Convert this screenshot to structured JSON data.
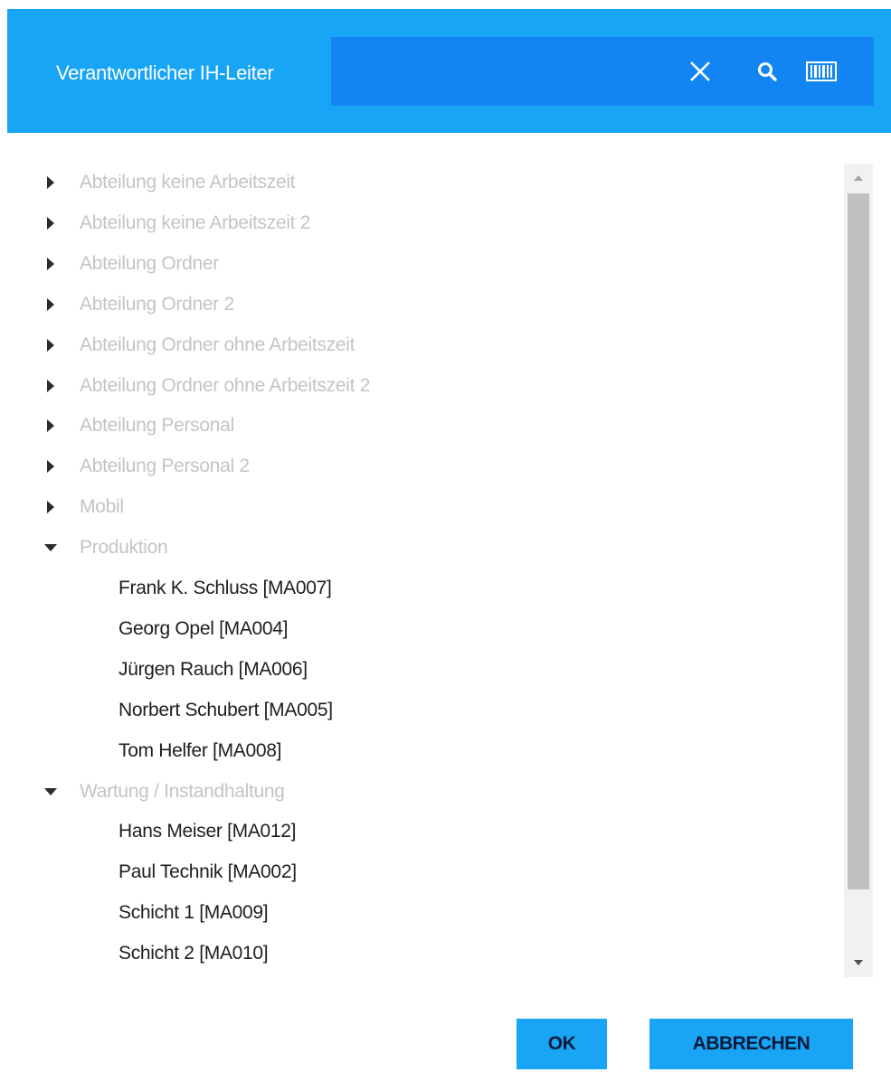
{
  "header": {
    "title": "Verantwortlicher IH-Leiter",
    "search": {
      "value": "",
      "placeholder": ""
    },
    "icons": {
      "clear": "close-icon",
      "search": "search-icon",
      "barcode": "barcode-icon"
    },
    "background_color": "#18a5f5",
    "search_color": "#1385f2"
  },
  "tree": {
    "items": [
      {
        "type": "group",
        "label": "Abteilung keine Arbeitszeit",
        "expanded": false
      },
      {
        "type": "group",
        "label": "Abteilung keine Arbeitszeit 2",
        "expanded": false
      },
      {
        "type": "group",
        "label": "Abteilung Ordner",
        "expanded": false
      },
      {
        "type": "group",
        "label": "Abteilung Ordner 2",
        "expanded": false
      },
      {
        "type": "group",
        "label": "Abteilung Ordner ohne Arbeitszeit",
        "expanded": false
      },
      {
        "type": "group",
        "label": "Abteilung Ordner ohne Arbeitszeit 2",
        "expanded": false
      },
      {
        "type": "group",
        "label": "Abteilung Personal",
        "expanded": false
      },
      {
        "type": "group",
        "label": "Abteilung Personal 2",
        "expanded": false
      },
      {
        "type": "group",
        "label": "Mobil",
        "expanded": false
      },
      {
        "type": "group",
        "label": "Produktion",
        "expanded": true
      },
      {
        "type": "person",
        "label": "Frank K. Schluss [MA007]"
      },
      {
        "type": "person",
        "label": "Georg Opel [MA004]"
      },
      {
        "type": "person",
        "label": "Jürgen Rauch [MA006]"
      },
      {
        "type": "person",
        "label": "Norbert Schubert [MA005]"
      },
      {
        "type": "person",
        "label": "Tom Helfer [MA008]"
      },
      {
        "type": "group",
        "label": "Wartung / Instandhaltung",
        "expanded": true
      },
      {
        "type": "person",
        "label": "Hans Meiser [MA012]"
      },
      {
        "type": "person",
        "label": "Paul Technik [MA002]"
      },
      {
        "type": "person",
        "label": "Schicht 1 [MA009]"
      },
      {
        "type": "person",
        "label": "Schicht 2 [MA010]"
      }
    ]
  },
  "footer": {
    "ok_label": "OK",
    "cancel_label": "ABBRECHEN"
  }
}
